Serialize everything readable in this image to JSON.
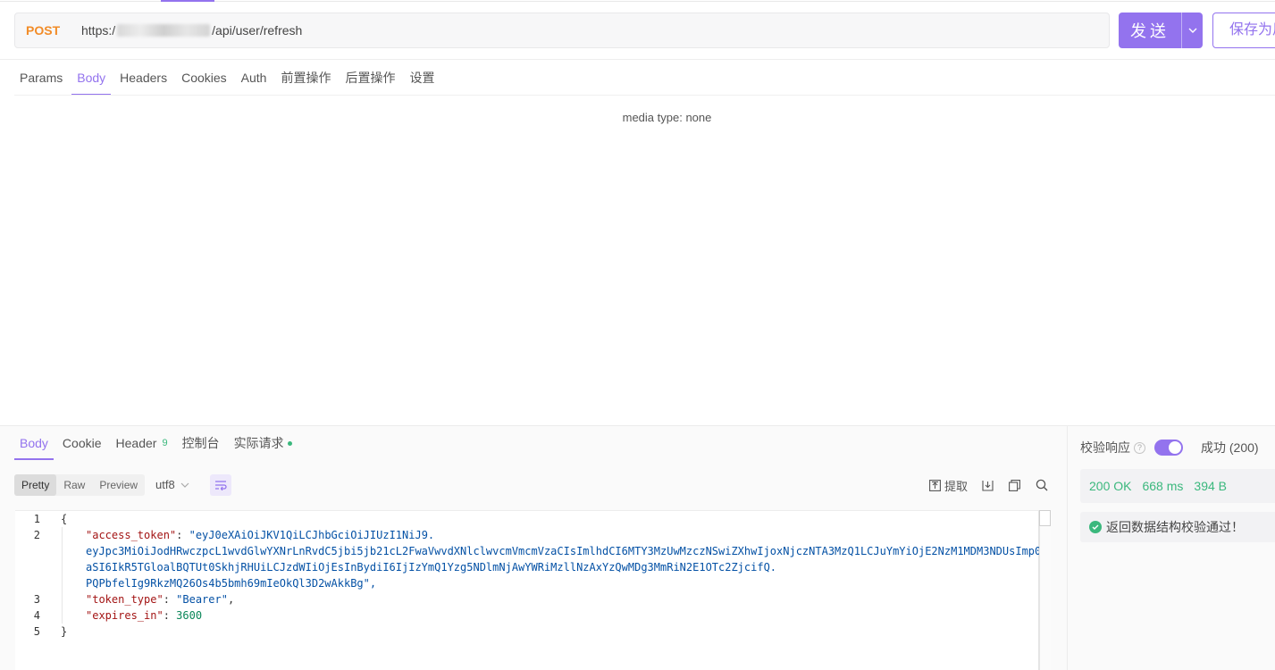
{
  "request": {
    "method": "POST",
    "url_prefix": "https:/",
    "url_suffix": "/api/user/refresh",
    "send_label": "发送",
    "save_label": "保存为用例"
  },
  "request_tabs": [
    "Params",
    "Body",
    "Headers",
    "Cookies",
    "Auth",
    "前置操作",
    "后置操作",
    "设置"
  ],
  "body": {
    "media_type": "media type: none"
  },
  "response": {
    "tabs": {
      "body": "Body",
      "cookie": "Cookie",
      "header": "Header",
      "header_count": "9",
      "console": "控制台",
      "actual_request": "实际请求"
    },
    "views": [
      "Pretty",
      "Raw",
      "Preview"
    ],
    "encoding": "utf8",
    "tools": {
      "extract": "提取"
    },
    "code": {
      "line_numbers": [
        "1",
        "2",
        "3",
        "4",
        "5"
      ],
      "open_brace": "{",
      "close_brace": "}",
      "access_token_key": "\"access_token\"",
      "access_token_value_lines": [
        "\"eyJ0eXAiOiJKV1QiLCJhbGciOiJIUzI1NiJ9.",
        "eyJpc3MiOiJodHRwczpcL1wvdGlwYXNrLnRvdC5jbi5jb21cL2FwaVwvdXNlclwvcmVmcmVzaCIsImlhdCI6MTY3MzUwMzczNSwiZXhwIjoxNjczNTA3MzQ1LCJuYmYiOjE2NzM1MDM3NDUsImp0",
        "aSI6IkR5TGloalBQTUt0SkhjRHUiLCJzdWIiOjEsInBydiI6IjIzYmQ1Yzg5NDlmNjAwYWRiMzllNzAxYzQwMDg3MmRiN2E1OTc2ZjcifQ.",
        "PQPbfelIg9RkzMQ26Os4b5bmh69mIeOkQl3D2wAkkBg\","
      ],
      "token_type_key": "\"token_type\"",
      "token_type_value": "\"Bearer\"",
      "expires_in_key": "\"expires_in\"",
      "expires_in_value": "3600"
    }
  },
  "side": {
    "verify_label": "校验响应",
    "help_mark": "?",
    "result": "成功 (200)",
    "status": "200 OK",
    "time": "668 ms",
    "size": "394 B",
    "check_message": "返回数据结构校验通过！"
  },
  "colors": {
    "accent": "#9373ee",
    "success": "#3bb87d",
    "method": "#f28c28"
  }
}
